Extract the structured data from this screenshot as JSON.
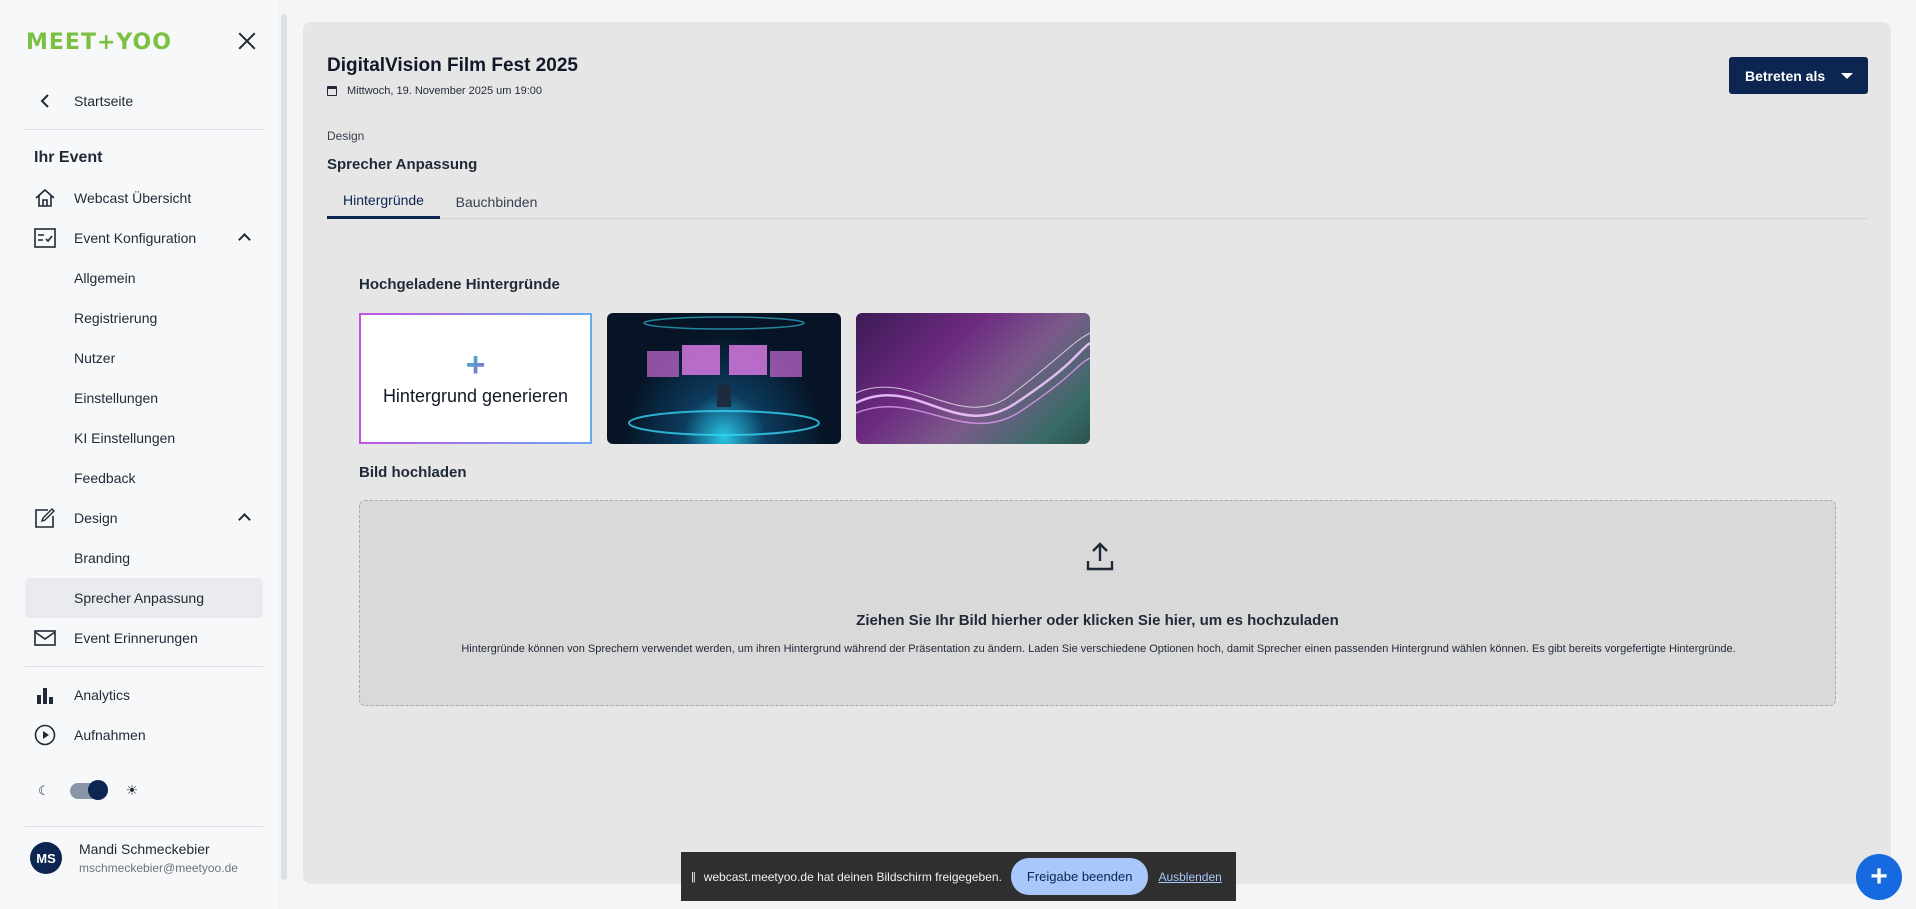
{
  "brand": {
    "logo_text": "MEET+YOO",
    "accent_color": "#7ac143",
    "primary_color": "#0c2551"
  },
  "sidebar": {
    "back_label": "Startseite",
    "section_title": "Ihr Event",
    "items": [
      {
        "label": "Webcast Übersicht",
        "icon": "home-icon"
      },
      {
        "label": "Event Konfiguration",
        "icon": "checklist-icon",
        "expanded": true
      },
      {
        "label": "Allgemein"
      },
      {
        "label": "Registrierung"
      },
      {
        "label": "Nutzer"
      },
      {
        "label": "Einstellungen"
      },
      {
        "label": "KI Einstellungen"
      },
      {
        "label": "Feedback"
      },
      {
        "label": "Design",
        "icon": "edit-icon",
        "expanded": true
      },
      {
        "label": "Branding"
      },
      {
        "label": "Sprecher Anpassung",
        "active": true
      },
      {
        "label": "Event Erinnerungen",
        "icon": "mail-icon"
      },
      {
        "label": "Analytics",
        "icon": "bar-chart-icon"
      },
      {
        "label": "Aufnahmen",
        "icon": "play-circle-icon"
      }
    ],
    "theme_toggle": {
      "state": "light"
    },
    "user": {
      "initials": "MS",
      "name": "Mandi Schmeckebier",
      "email": "mschmeckebier@meetyoo.de"
    }
  },
  "header": {
    "title": "DigitalVision Film Fest 2025",
    "date": "Mittwoch, 19. November 2025 um 19:00",
    "enter_button": "Betreten als"
  },
  "page": {
    "breadcrumb": "Design",
    "subtitle": "Sprecher Anpassung",
    "tabs": [
      {
        "label": "Hintergründe",
        "active": true
      },
      {
        "label": "Bauchbinden"
      }
    ],
    "uploaded_heading": "Hochgeladene Hintergründe",
    "generate_label": "Hintergrund generieren",
    "upload_heading": "Bild hochladen",
    "drop_main": "Ziehen Sie Ihr Bild hierher oder klicken Sie hier, um es hochzuladen",
    "drop_sub": "Hintergründe können von Sprechern verwendet werden, um ihren Hintergrund während der Präsentation zu ändern. Laden Sie verschiedene Optionen hoch, damit Sprecher einen passenden Hintergrund wählen können. Es gibt bereits vorgefertigte Hintergründe."
  },
  "sharebar": {
    "message": "webcast.meetyoo.de hat deinen Bildschirm freigegeben.",
    "end_button": "Freigabe beenden",
    "hide_link": "Ausblenden"
  }
}
